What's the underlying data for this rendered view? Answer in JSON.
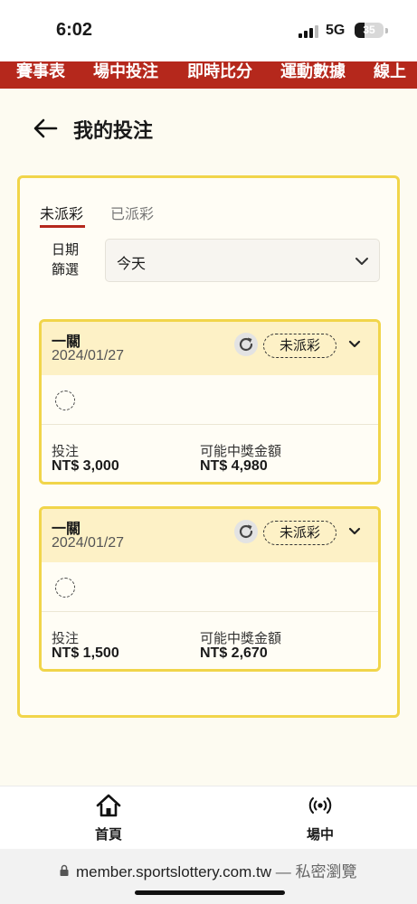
{
  "status_bar": {
    "time": "6:02",
    "network": "5G",
    "battery": 35
  },
  "top_nav": {
    "items": [
      "賽事表",
      "場中投注",
      "即時比分",
      "運動數據",
      "線上"
    ]
  },
  "header": {
    "title": "我的投注"
  },
  "tabs": [
    {
      "label": "未派彩",
      "active": true
    },
    {
      "label": "已派彩",
      "active": false
    }
  ],
  "filter": {
    "label": "日期篩選",
    "selected": "今天"
  },
  "bets": [
    {
      "type": "一關",
      "date": "2024/01/27",
      "status": "未派彩",
      "stake_label": "投注",
      "stake": "NT$ 3,000",
      "payout_label": "可能中獎金額",
      "payout": "NT$ 4,980"
    },
    {
      "type": "一關",
      "date": "2024/01/27",
      "status": "未派彩",
      "stake_label": "投注",
      "stake": "NT$ 1,500",
      "payout_label": "可能中獎金額",
      "payout": "NT$ 2,670"
    }
  ],
  "bottom_nav": {
    "home": "首頁",
    "live": "場中"
  },
  "browser": {
    "url": "member.sportslottery.com.tw",
    "mode": " — 私密瀏覽"
  },
  "colors": {
    "brand_red": "#b5281c",
    "card_border": "#f1d54a",
    "card_header": "#fdf1c6"
  }
}
